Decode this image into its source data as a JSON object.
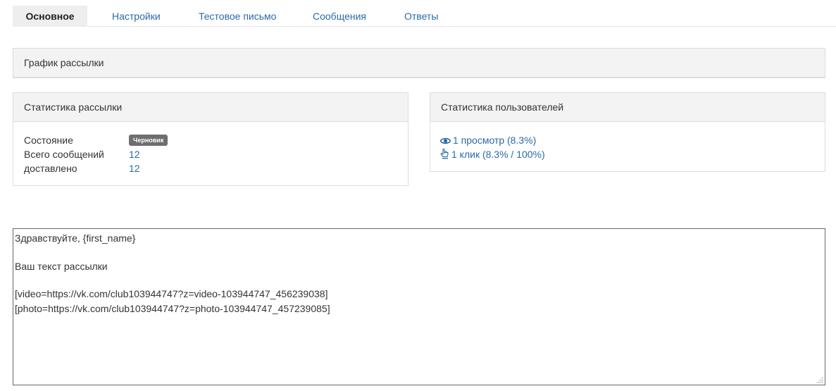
{
  "tabs": [
    {
      "label": "Основное",
      "active": true
    },
    {
      "label": "Настройки"
    },
    {
      "label": "Тестовое письмо"
    },
    {
      "label": "Сообщения"
    },
    {
      "label": "Ответы"
    }
  ],
  "schedule_panel": {
    "title": "График рассылки"
  },
  "mailing_stats": {
    "title": "Статистика рассылки",
    "status_label": "Состояние",
    "status_badge": "Черновик",
    "total_label": "Всего сообщений",
    "total_value": "12",
    "delivered_label": "доставлено",
    "delivered_value": "12"
  },
  "user_stats": {
    "title": "Статистика пользователей",
    "views": "1 просмотр (8.3%)",
    "clicks": "1 клик (8.3% / 100%)",
    "icons": {
      "views": "eye-icon",
      "clicks": "hand-pointer-icon"
    }
  },
  "editor": {
    "lines": [
      "Здравствуйте, {first_name}",
      "",
      "Ваш текст рассылки",
      "",
      "[video=https://vk.com/club103944747?z=video-103944747_456239038]",
      "[photo=https://vk.com/club103944747?z=photo-103944747_457239085]"
    ]
  },
  "colors": {
    "link": "#2a6aa6",
    "badge_bg": "#6e6e6e",
    "panel_head_bg": "#f3f3f3",
    "active_tab_bg": "#eeeeee"
  }
}
